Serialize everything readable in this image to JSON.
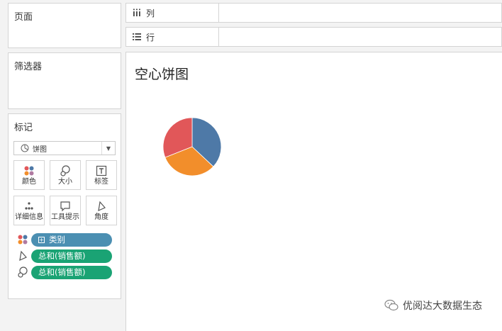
{
  "panels": {
    "pages_title": "页面",
    "filters_title": "筛选器",
    "marks_title": "标记"
  },
  "marks": {
    "type_selected": "饼图",
    "buttons": {
      "color": "颜色",
      "size": "大小",
      "label": "标签",
      "detail": "详细信息",
      "tooltip": "工具提示",
      "angle": "角度"
    },
    "pills": [
      {
        "text": "类别",
        "color": "#4b8fb2"
      },
      {
        "text": "总和(销售额)",
        "color": "#1aa374"
      },
      {
        "text": "总和(销售额)",
        "color": "#1aa374"
      }
    ]
  },
  "shelves": {
    "columns_label": "列",
    "rows_label": "行"
  },
  "view": {
    "title": "空心饼图"
  },
  "chart_data": {
    "type": "pie",
    "slices": [
      {
        "value": 37,
        "color": "#4e79a7"
      },
      {
        "value": 32,
        "color": "#f28e2b"
      },
      {
        "value": 31,
        "color": "#e15759"
      }
    ]
  },
  "watermark": {
    "text": "优阅达大数据生态"
  }
}
